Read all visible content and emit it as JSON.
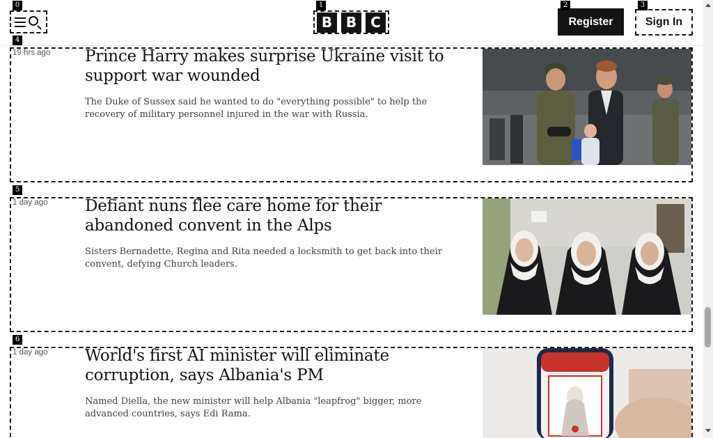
{
  "header": {
    "logo_letters": [
      "B",
      "B",
      "C"
    ],
    "register_label": "Register",
    "signin_label": "Sign In"
  },
  "badges": [
    "0",
    "1",
    "2",
    "3",
    "4",
    "5",
    "6"
  ],
  "articles": [
    {
      "time": "19 hrs ago",
      "title": "Prince Harry makes surprise Ukraine visit to support war wounded",
      "description": "The Duke of Sussex said he wanted to do \"everything possible\" to help the recovery of military personnel injured in the war with Russia."
    },
    {
      "time": "1 day ago",
      "title": "Defiant nuns flee care home for their abandoned convent in the Alps",
      "description": "Sisters Bernadette, Regina and Rita needed a locksmith to get back into their convent, defying Church leaders."
    },
    {
      "time": "1 day ago",
      "title": "World's first AI minister will eliminate corruption, says Albania's PM",
      "description": "Named Diella, the new minister will help Albania \"leapfrog\" bigger, more advanced countries, says Edi Rama."
    }
  ],
  "icons": {
    "menu": "hamburger-icon",
    "search": "search-icon"
  },
  "colors": {
    "text": "#141414",
    "accent": "#000000",
    "background": "#ffffff"
  }
}
